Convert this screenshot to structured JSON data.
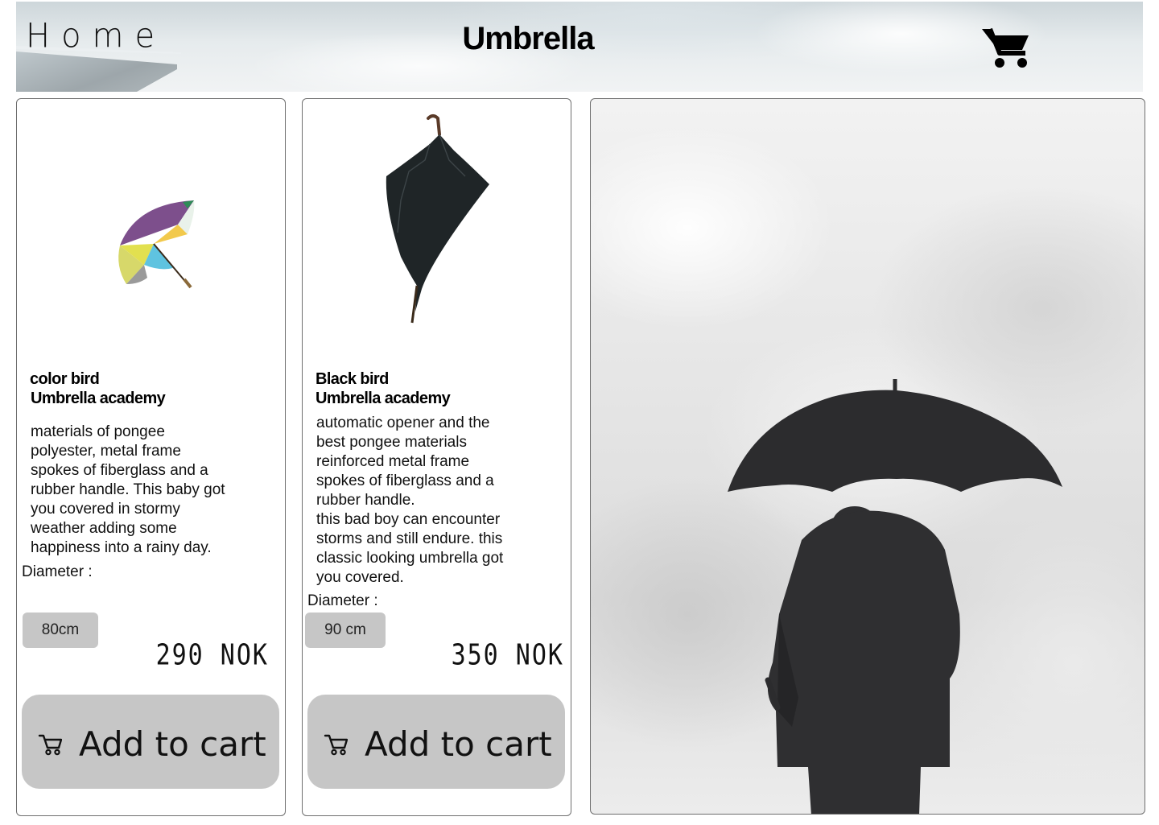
{
  "header": {
    "home_label": "Home",
    "title": "Umbrella",
    "cart_icon": "shopping-cart-icon"
  },
  "products": [
    {
      "name": "color bird",
      "brand": "Umbrella academy",
      "description": "materials of pongee\npolyester, metal frame\nspokes of fiberglass and a\nrubber handle. This baby got\nyou covered in stormy\nweather adding some\nhappiness into a rainy day.",
      "diameter_label": "Diameter :",
      "size": "80cm",
      "price": "290 NOK",
      "button_label": "Add to cart",
      "button_icon": "cart-icon"
    },
    {
      "name": "Black bird",
      "brand": "Umbrella academy",
      "description": "automatic opener and the\nbest pongee materials\nreinforced metal frame\nspokes of fiberglass and a\nrubber handle.\nthis bad boy can encounter\nstorms and still endure. this\nclassic looking umbrella got\nyou covered.",
      "diameter_label": "Diameter :",
      "size": "90 cm",
      "price": "350 NOK",
      "button_label": "Add to cart",
      "button_icon": "cart-icon"
    }
  ],
  "colors": {
    "button_bg": "#c6c6c6",
    "card_border": "#6f6f6f"
  }
}
